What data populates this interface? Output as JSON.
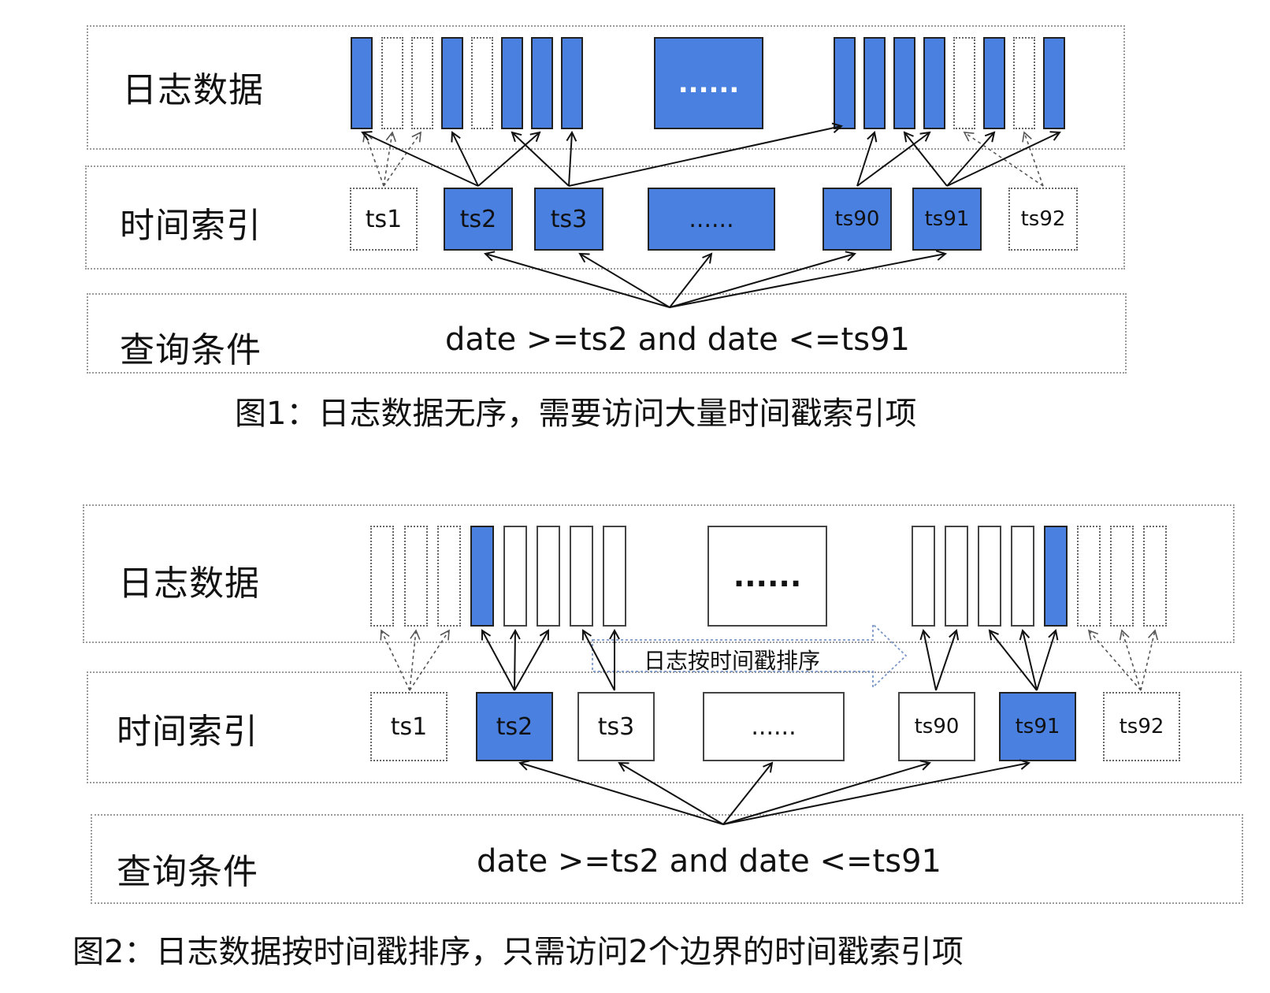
{
  "colors": {
    "accent": "#4a80e0",
    "border": "#222222",
    "dotted": "#9a9a9a"
  },
  "figure1": {
    "row_labels": {
      "log": "日志数据",
      "index": "时间索引",
      "query": "查询条件"
    },
    "log_ellipsis": "......",
    "index_boxes": [
      "ts1",
      "ts2",
      "ts3",
      "......",
      "ts90",
      "ts91",
      "ts92"
    ],
    "query": "date >=ts2 and date <=ts91",
    "caption": "图1：日志数据无序，需要访问大量时间戳索引项"
  },
  "figure2": {
    "row_labels": {
      "log": "日志数据",
      "index": "时间索引",
      "query": "查询条件"
    },
    "log_ellipsis": "......",
    "sort_label": "日志按时间戳排序",
    "index_boxes": [
      "ts1",
      "ts2",
      "ts3",
      "......",
      "ts90",
      "ts91",
      "ts92"
    ],
    "query": "date >=ts2 and date <=ts91",
    "caption": "图2：日志数据按时间戳排序，只需访问2个边界的时间戳索引项"
  }
}
